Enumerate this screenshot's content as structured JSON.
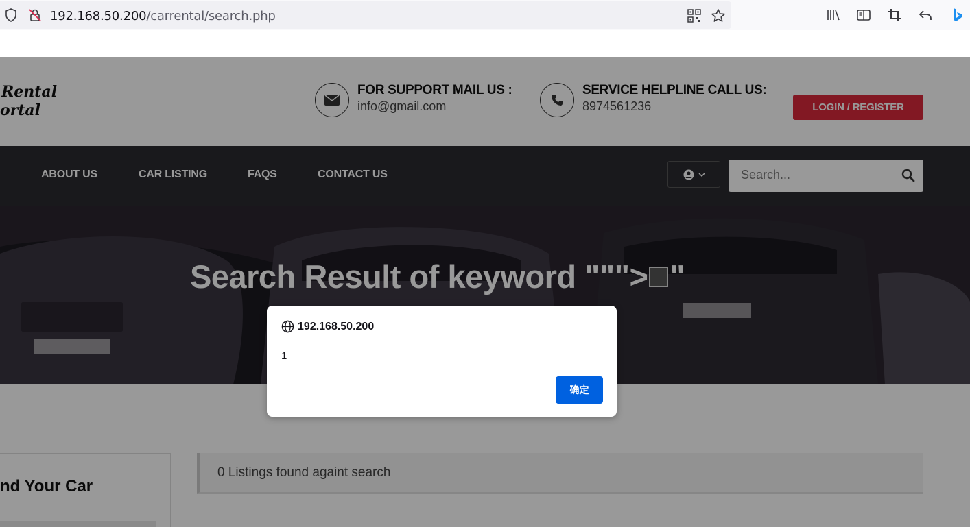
{
  "browser": {
    "url_host": "192.168.50.200",
    "url_path": "/carrental/search.php",
    "icons": [
      "shield-icon",
      "insecure-lock-icon",
      "qr-code-icon",
      "bookmark-star-icon",
      "library-icon",
      "reader-view-icon",
      "screenshot-crop-icon",
      "back-arrow-icon",
      "bing-icon"
    ]
  },
  "header": {
    "logo_line1": "Rental",
    "logo_line2": "ortal",
    "support_title": "FOR SUPPORT MAIL US :",
    "support_email": "info@gmail.com",
    "helpline_title": "SERVICE HELPLINE CALL US:",
    "helpline_phone": "8974561236",
    "login_label": "LOGIN / REGISTER"
  },
  "nav": {
    "items": [
      "ABOUT US",
      "CAR LISTING",
      "FAQS",
      "CONTACT US"
    ],
    "search_placeholder": "Search..."
  },
  "hero": {
    "title_prefix": "Search Result of keyword \"\"\">",
    "title_suffix": "\""
  },
  "content": {
    "sidebar_title": "nd Your Car",
    "result_text": "0 Listings found againt search"
  },
  "dialog": {
    "origin": "192.168.50.200",
    "message": "1",
    "ok_label": "确定"
  },
  "colors": {
    "accent_red": "#d9283b",
    "navbar": "#2b2b2f",
    "dialog_button": "#0061e0"
  }
}
